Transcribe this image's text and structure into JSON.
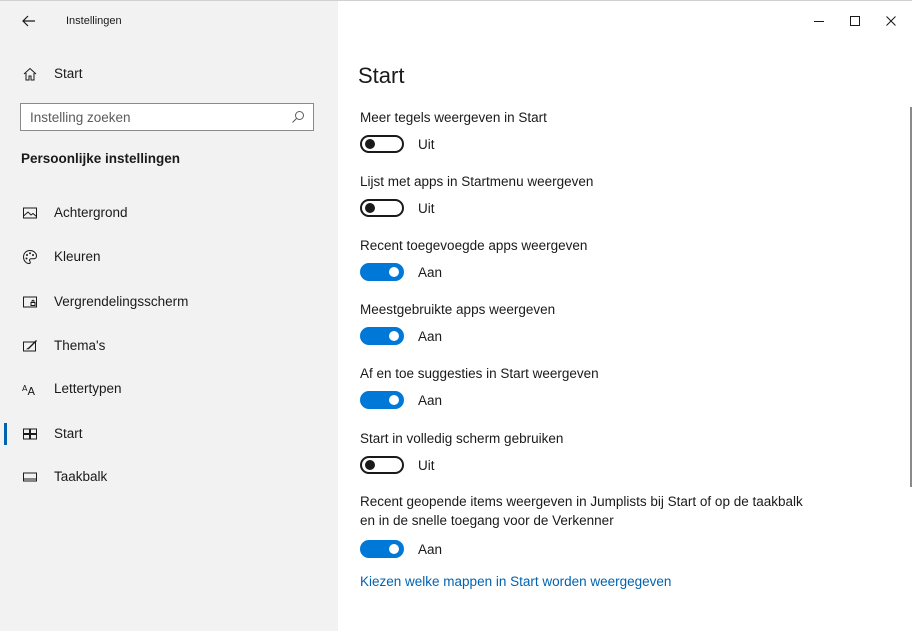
{
  "window": {
    "app_title": "Instellingen",
    "controls": {
      "minimize": "minimize-icon",
      "maximize": "maximize-icon",
      "close": "close-icon"
    }
  },
  "sidebar": {
    "home_label": "Start",
    "search_placeholder": "Instelling zoeken",
    "search_value": "",
    "section_title": "Persoonlijke instellingen",
    "items": [
      {
        "label": "Achtergrond",
        "icon": "picture-icon",
        "selected": false
      },
      {
        "label": "Kleuren",
        "icon": "palette-icon",
        "selected": false
      },
      {
        "label": "Vergrendelingsscherm",
        "icon": "lock-screen-icon",
        "selected": false
      },
      {
        "label": "Thema's",
        "icon": "theme-icon",
        "selected": false
      },
      {
        "label": "Lettertypen",
        "icon": "font-icon",
        "selected": false
      },
      {
        "label": "Start",
        "icon": "start-tiles-icon",
        "selected": true
      },
      {
        "label": "Taakbalk",
        "icon": "taskbar-icon",
        "selected": false
      }
    ]
  },
  "main": {
    "title": "Start",
    "settings": [
      {
        "label": "Meer tegels weergeven in Start",
        "state": "Uit",
        "on": false
      },
      {
        "label": "Lijst met apps in Startmenu weergeven",
        "state": "Uit",
        "on": false
      },
      {
        "label": "Recent toegevoegde apps weergeven",
        "state": "Aan",
        "on": true
      },
      {
        "label": "Meestgebruikte apps weergeven",
        "state": "Aan",
        "on": true
      },
      {
        "label": "Af en toe suggesties in Start weergeven",
        "state": "Aan",
        "on": true
      },
      {
        "label": "Start in volledig scherm gebruiken",
        "state": "Uit",
        "on": false
      },
      {
        "label": "Recent geopende items weergeven in Jumplists bij Start of op de taakbalk en in de snelle toegang voor de Verkenner",
        "state": "Aan",
        "on": true
      }
    ],
    "link": "Kiezen welke mappen in Start worden weergegeven"
  },
  "colors": {
    "accent": "#0078d7",
    "link": "#0063b1",
    "sidebar_bg": "#f2f2f2"
  }
}
